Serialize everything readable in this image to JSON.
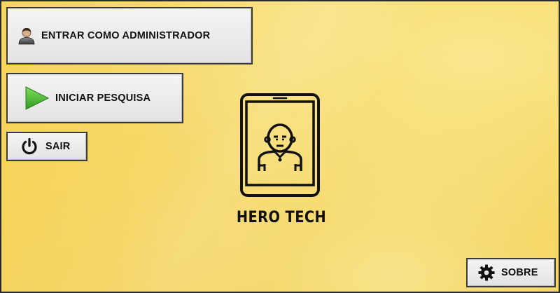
{
  "menu": {
    "admin_label": "ENTRAR COMO ADMINISTRADOR",
    "start_label": "INICIAR PESQUISA",
    "exit_label": "SAIR",
    "about_label": "SOBRE"
  },
  "brand": {
    "name": "HERO TECH"
  },
  "icons": {
    "admin": "user-icon",
    "start": "play-icon",
    "exit": "power-icon",
    "about": "gear-icon",
    "logo": "smartphone-person-logo"
  },
  "colors": {
    "background": "#f5d251",
    "button_face": "#e8e8e8",
    "button_border": "#3a3a3a",
    "play_green": "#3cb52e",
    "text": "#111111"
  }
}
